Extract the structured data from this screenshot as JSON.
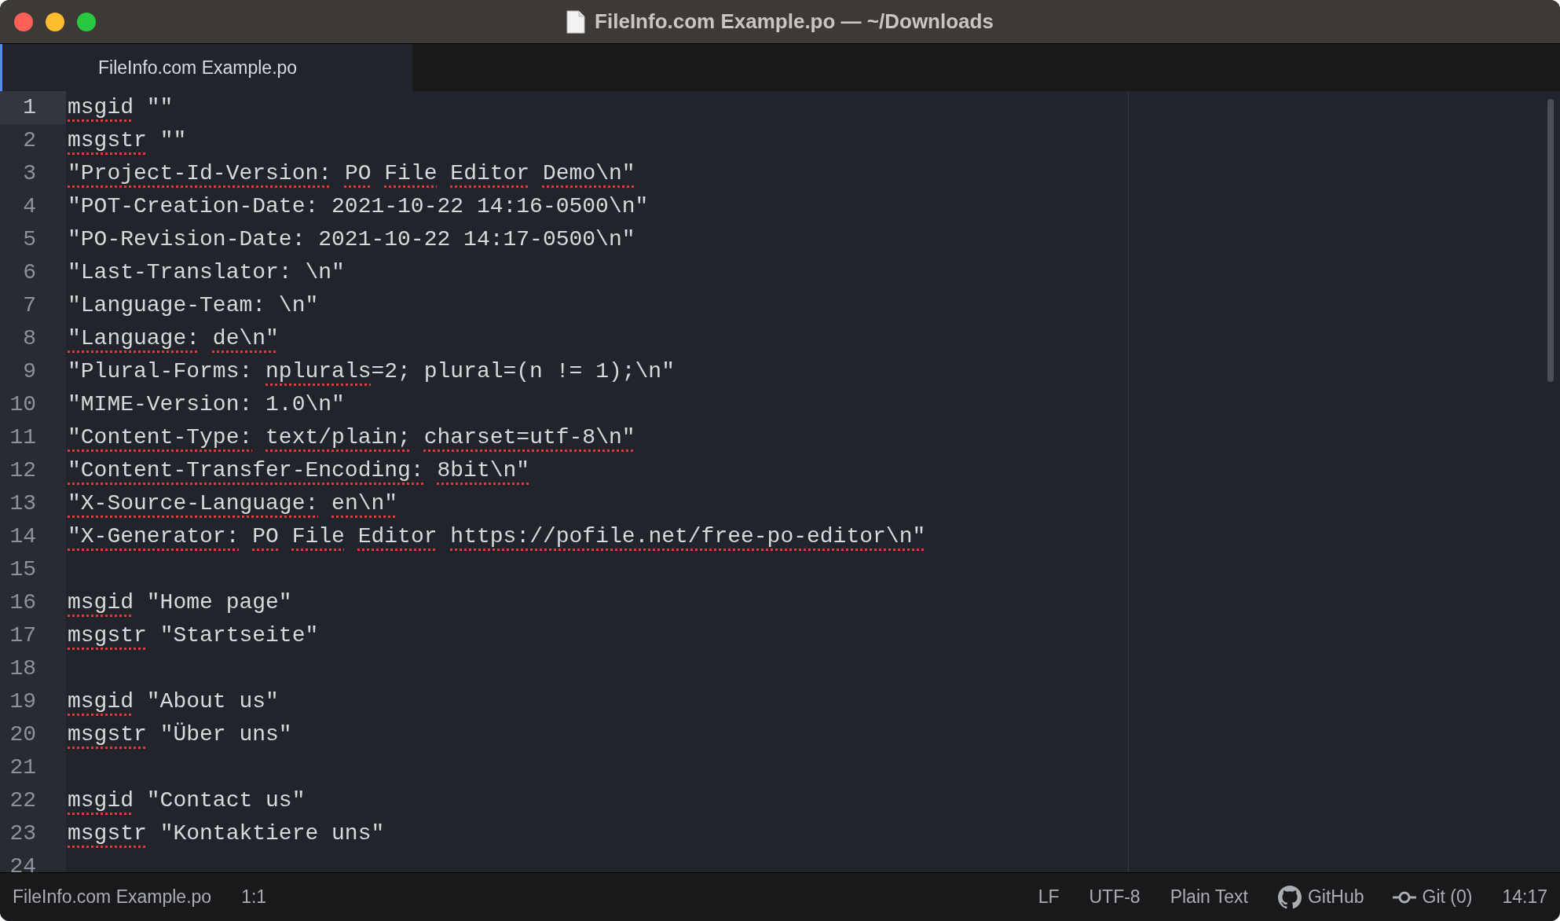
{
  "window": {
    "title": "FileInfo.com Example.po — ~/Downloads"
  },
  "tabs": [
    {
      "label": "FileInfo.com Example.po",
      "selected": true
    }
  ],
  "editor": {
    "lines": [
      {
        "number": "1",
        "current": true,
        "segments": [
          {
            "text": "msgid",
            "flagged": true
          },
          {
            "text": " \"\"",
            "flagged": false
          }
        ]
      },
      {
        "number": "2",
        "current": false,
        "segments": [
          {
            "text": "msgstr",
            "flagged": true
          },
          {
            "text": " \"\"",
            "flagged": false
          }
        ]
      },
      {
        "number": "3",
        "current": false,
        "segments": [
          {
            "text": "\"Project-Id-Version: ",
            "flagged": true
          },
          {
            "text": "PO ",
            "flagged": true
          },
          {
            "text": "File ",
            "flagged": true
          },
          {
            "text": "Editor ",
            "flagged": true
          },
          {
            "text": "Demo\\n\"",
            "flagged": true
          }
        ]
      },
      {
        "number": "4",
        "current": false,
        "segments": [
          {
            "text": "\"POT-Creation-Date: 2021-10-22 14:16-0500\\n\"",
            "flagged": false
          }
        ]
      },
      {
        "number": "5",
        "current": false,
        "segments": [
          {
            "text": "\"PO-Revision-Date: 2021-10-22 14:17-0500\\n\"",
            "flagged": false
          }
        ]
      },
      {
        "number": "6",
        "current": false,
        "segments": [
          {
            "text": "\"Last-Translator: \\n\"",
            "flagged": false
          }
        ]
      },
      {
        "number": "7",
        "current": false,
        "segments": [
          {
            "text": "\"Language-Team: \\n\"",
            "flagged": false
          }
        ]
      },
      {
        "number": "8",
        "current": false,
        "segments": [
          {
            "text": "\"Language: ",
            "flagged": true
          },
          {
            "text": "de\\n\"",
            "flagged": true
          }
        ]
      },
      {
        "number": "9",
        "current": false,
        "segments": [
          {
            "text": "\"Plural-Forms: ",
            "flagged": false
          },
          {
            "text": "nplurals",
            "flagged": true
          },
          {
            "text": "=2; plural=(n != 1);\\n\"",
            "flagged": false
          }
        ]
      },
      {
        "number": "10",
        "current": false,
        "segments": [
          {
            "text": "\"MIME-Version: 1.0\\n\"",
            "flagged": false
          }
        ]
      },
      {
        "number": "11",
        "current": false,
        "segments": [
          {
            "text": "\"Content-Type: ",
            "flagged": true
          },
          {
            "text": "text/plain; ",
            "flagged": true
          },
          {
            "text": "charset=utf-8\\n\"",
            "flagged": true
          }
        ]
      },
      {
        "number": "12",
        "current": false,
        "segments": [
          {
            "text": "\"Content-Transfer-Encoding: ",
            "flagged": true
          },
          {
            "text": "8bit\\n\"",
            "flagged": true
          }
        ]
      },
      {
        "number": "13",
        "current": false,
        "segments": [
          {
            "text": "\"X-Source-Language: ",
            "flagged": true
          },
          {
            "text": "en\\n\"",
            "flagged": true
          }
        ]
      },
      {
        "number": "14",
        "current": false,
        "segments": [
          {
            "text": "\"X-Generator: ",
            "flagged": true
          },
          {
            "text": "PO ",
            "flagged": true
          },
          {
            "text": "File ",
            "flagged": true
          },
          {
            "text": "Editor ",
            "flagged": true
          },
          {
            "text": "https://pofile.net/free-po-editor\\n\"",
            "flagged": true
          }
        ]
      },
      {
        "number": "15",
        "current": false
      },
      {
        "number": "16",
        "current": false,
        "segments": [
          {
            "text": "msgid",
            "flagged": true
          },
          {
            "text": " \"Home page\"",
            "flagged": false
          }
        ]
      },
      {
        "number": "17",
        "current": false,
        "segments": [
          {
            "text": "msgstr",
            "flagged": true
          },
          {
            "text": " \"Startseite\"",
            "flagged": false
          }
        ]
      },
      {
        "number": "18",
        "current": false
      },
      {
        "number": "19",
        "current": false,
        "segments": [
          {
            "text": "msgid",
            "flagged": true
          },
          {
            "text": " \"About us\"",
            "flagged": false
          }
        ]
      },
      {
        "number": "20",
        "current": false,
        "segments": [
          {
            "text": "msgstr",
            "flagged": true
          },
          {
            "text": " \"Über uns\"",
            "flagged": false
          }
        ]
      },
      {
        "number": "21",
        "current": false
      },
      {
        "number": "22",
        "current": false,
        "segments": [
          {
            "text": "msgid",
            "flagged": true
          },
          {
            "text": " \"Contact us\"",
            "flagged": false
          }
        ]
      },
      {
        "number": "23",
        "current": false,
        "segments": [
          {
            "text": "msgstr",
            "flagged": true
          },
          {
            "text": " \"Kontaktiere uns\"",
            "flagged": false
          }
        ]
      },
      {
        "number": "24",
        "current": false
      }
    ]
  },
  "status_bar": {
    "file": "FileInfo.com Example.po",
    "position": "1:1",
    "line_ending": "LF",
    "encoding": "UTF-8",
    "grammar": "Plain Text",
    "github": "GitHub",
    "git": "Git (0)",
    "time": "14:17"
  }
}
